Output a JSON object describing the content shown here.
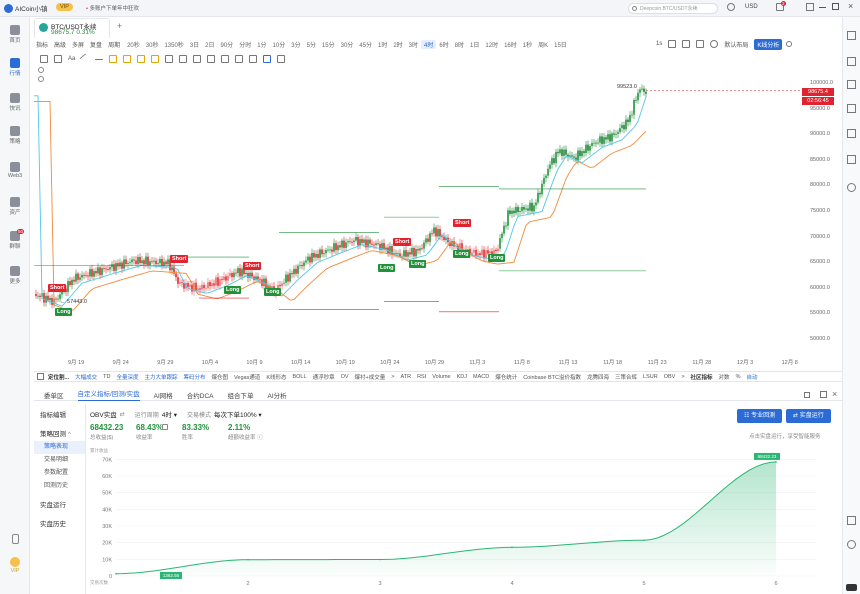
{
  "app": {
    "name": "AICoin小镇",
    "vip": "VIP",
    "notice": "多账户下单年中狂欢"
  },
  "tab": {
    "title": "BTC/USDT永续",
    "price": "98675.7",
    "change": "0.31%",
    "add": "+"
  },
  "titlebar": {
    "search_placeholder": "Deepcoin BTC/USDT永续",
    "currency": "USD",
    "notif_count": "2"
  },
  "leftnav": [
    {
      "label": "首页",
      "icon": "home-icon"
    },
    {
      "label": "行情",
      "icon": "chart-icon"
    },
    {
      "label": "快讯",
      "icon": "news-icon"
    },
    {
      "label": "策略",
      "icon": "strategy-icon"
    },
    {
      "label": "Web3",
      "icon": "web3-icon"
    },
    {
      "label": "资产",
      "icon": "wallet-icon"
    },
    {
      "label": "群聊",
      "icon": "chat-icon",
      "badge": "50"
    },
    {
      "label": "更多",
      "icon": "more-icon"
    }
  ],
  "leftnav_bottom": {
    "vip": "VIP"
  },
  "toolbar": {
    "items": [
      "指标",
      "高级",
      "多屏",
      "复盘",
      "周期"
    ],
    "timeframes": [
      "20秒",
      "30秒",
      "1350秒",
      "3日",
      "2日",
      "90分",
      "分时",
      "1分",
      "10分",
      "3分",
      "5分",
      "15分",
      "30分",
      "45分",
      "1时",
      "2时",
      "3时",
      "4时",
      "6时",
      "8时",
      "1日",
      "12时",
      "16时",
      "1秒",
      "周K",
      "15日"
    ],
    "active_tf": "4时",
    "right": {
      "sec": "1s",
      "layout": "默认布局",
      "kline": "K线分析"
    }
  },
  "chart": {
    "high_label": "99523.0",
    "low_label": "57443.0",
    "price_tag": "98675.4",
    "countdown": "02:56:45",
    "y_ticks": [
      "100000.0",
      "95000.0",
      "90000.0",
      "85000.0",
      "80000.0",
      "75000.0",
      "70000.0",
      "65000.0",
      "60000.0",
      "55000.0",
      "50000.0"
    ],
    "x_ticks": [
      "9月 19",
      "9月 24",
      "9月 29",
      "10月 4",
      "10月 9",
      "10月 14",
      "10月 19",
      "10月 24",
      "10月 29",
      "11月 3",
      "11月 8",
      "11月 13",
      "11月 18",
      "11月 23",
      "11月 28",
      "12月 3",
      "12月 8"
    ],
    "signals": [
      {
        "type": "Short",
        "text": "Short"
      },
      {
        "type": "Long",
        "text": "Long"
      },
      {
        "type": "Short",
        "text": "Short"
      },
      {
        "type": "Short",
        "text": "Short"
      },
      {
        "type": "Long",
        "text": "Long"
      },
      {
        "type": "Long",
        "text": "Long"
      },
      {
        "type": "Short",
        "text": "Short"
      },
      {
        "type": "Long",
        "text": "Long"
      },
      {
        "type": "Long",
        "text": "Long"
      },
      {
        "type": "Short",
        "text": "Short"
      },
      {
        "type": "Long",
        "text": "Long"
      },
      {
        "type": "Long",
        "text": "Long"
      }
    ]
  },
  "indicators": {
    "left": "主图",
    "items": [
      "定位割...",
      "大幅成交",
      "TD",
      "全量深度",
      "主力大单跟踪",
      "筹码分布",
      "爆仓图",
      "Vegas通道",
      "K线形态",
      "BOLL",
      "通浮秒章",
      "OV",
      "爆衬+成交量",
      ">",
      "ATR",
      "RSI",
      "Volume",
      "KDJ",
      "MACD",
      "爆仓统计",
      "Coinbase BTC溢价指数",
      "龙腾四海",
      "三策合辉",
      "LSUR",
      "OBV",
      ">"
    ],
    "hot": [
      "大幅成交",
      "全量深度",
      "主力大单跟踪",
      "筹码分布"
    ],
    "right": [
      "社区指标",
      "对数",
      "%",
      "自动"
    ]
  },
  "panel": {
    "tabs": [
      "委单区",
      "自定义指标/回测/实盘",
      "AI网格",
      "合约DCA",
      "组合下单",
      "AI分析"
    ],
    "active_tab": "自定义指标/回测/实盘",
    "menu": [
      {
        "label": "指标编辑",
        "sub": false
      },
      {
        "label": "策略回测",
        "sub": false,
        "expanded": true
      },
      {
        "label": "策略表现",
        "sub": true,
        "active": true
      },
      {
        "label": "交易明细",
        "sub": true
      },
      {
        "label": "参数配置",
        "sub": true
      },
      {
        "label": "回测历史",
        "sub": true
      },
      {
        "label": "实盘运行",
        "sub": false
      },
      {
        "label": "实盘历史",
        "sub": false
      }
    ],
    "controls": {
      "strategy": "OBV实盘",
      "period_label": "运行周期",
      "period_value": "4时",
      "mode_label": "交易模式",
      "mode_value": "每次下单100%"
    },
    "stats": [
      {
        "value": "68432.23",
        "label": "总收益($)",
        "color": "#21923a"
      },
      {
        "value": "68.43%",
        "label": "收益率",
        "color": "#21923a"
      },
      {
        "value": "83.33%",
        "label": "胜率",
        "color": "#21923a"
      },
      {
        "value": "2.11%",
        "label": "超额收益率",
        "color": "#21923a"
      }
    ],
    "buttons": {
      "pro": "专业回测",
      "live": "实盘运行",
      "hint": "点击实盘运行，享受智能服务"
    },
    "equity": {
      "y_label": "累计收益",
      "y_ticks": [
        "70K",
        "60K",
        "50K",
        "40K",
        "30K",
        "20K",
        "10K",
        "0"
      ],
      "x_label": "交易次数",
      "x_ticks": [
        "2",
        "3",
        "4",
        "5",
        "6"
      ],
      "start_label": "1362.56",
      "end_label": "68432.23"
    }
  },
  "chart_data": {
    "type": "area",
    "x": [
      1,
      2,
      3,
      4,
      5,
      6
    ],
    "series": [
      {
        "values": [
          1362.56,
          9800,
          9900,
          17200,
          21500,
          68432.23
        ]
      }
    ],
    "ylim": [
      0,
      72000
    ]
  }
}
